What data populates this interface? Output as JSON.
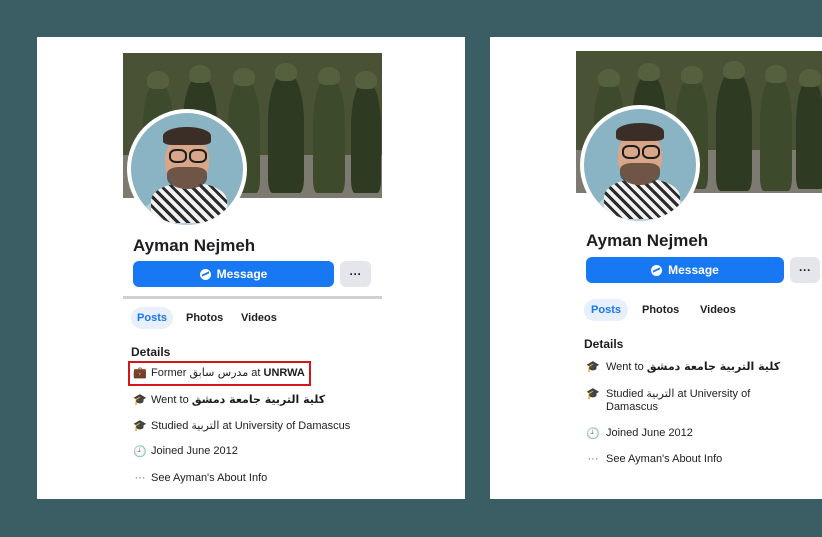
{
  "colors": {
    "background": "#3b5d64",
    "facebook_blue": "#1877f2",
    "highlight_red": "#d5141c"
  },
  "left": {
    "name": "Ayman Nejmeh",
    "message_button": "Message",
    "more_button": "···",
    "tabs": [
      "Posts",
      "Photos",
      "Videos"
    ],
    "details_title": "Details",
    "work": {
      "icon": "briefcase-icon",
      "prefix": "Former ",
      "role": "مدرس سابق",
      "middle": " at ",
      "employer": "UNRWA"
    },
    "went_to": {
      "icon": "graduation-cap-icon",
      "prefix": "Went to ",
      "school": "كلية التربية جامعة دمشق"
    },
    "studied": {
      "icon": "graduation-cap-icon",
      "prefix": "Studied ",
      "field": "التربية",
      "suffix": " at University of Damascus"
    },
    "joined": {
      "icon": "clock-icon",
      "text": "Joined June 2012"
    },
    "about": {
      "icon": "more-dots-icon",
      "glyph": "···",
      "text": "See Ayman's About Info"
    }
  },
  "right": {
    "name": "Ayman Nejmeh",
    "message_button": "Message",
    "more_button": "···",
    "tabs": [
      "Posts",
      "Photos",
      "Videos"
    ],
    "details_title": "Details",
    "went_to": {
      "icon": "graduation-cap-icon",
      "prefix": "Went to ",
      "school": "كلية التربية جامعة دمشق"
    },
    "studied": {
      "icon": "graduation-cap-icon",
      "prefix": "Studied ",
      "field": "التربية",
      "suffix": " at University of",
      "suffix_line2": "Damascus"
    },
    "joined": {
      "icon": "clock-icon",
      "text": "Joined June 2012"
    },
    "about": {
      "icon": "more-dots-icon",
      "glyph": "···",
      "text": "See Ayman's About Info"
    }
  }
}
